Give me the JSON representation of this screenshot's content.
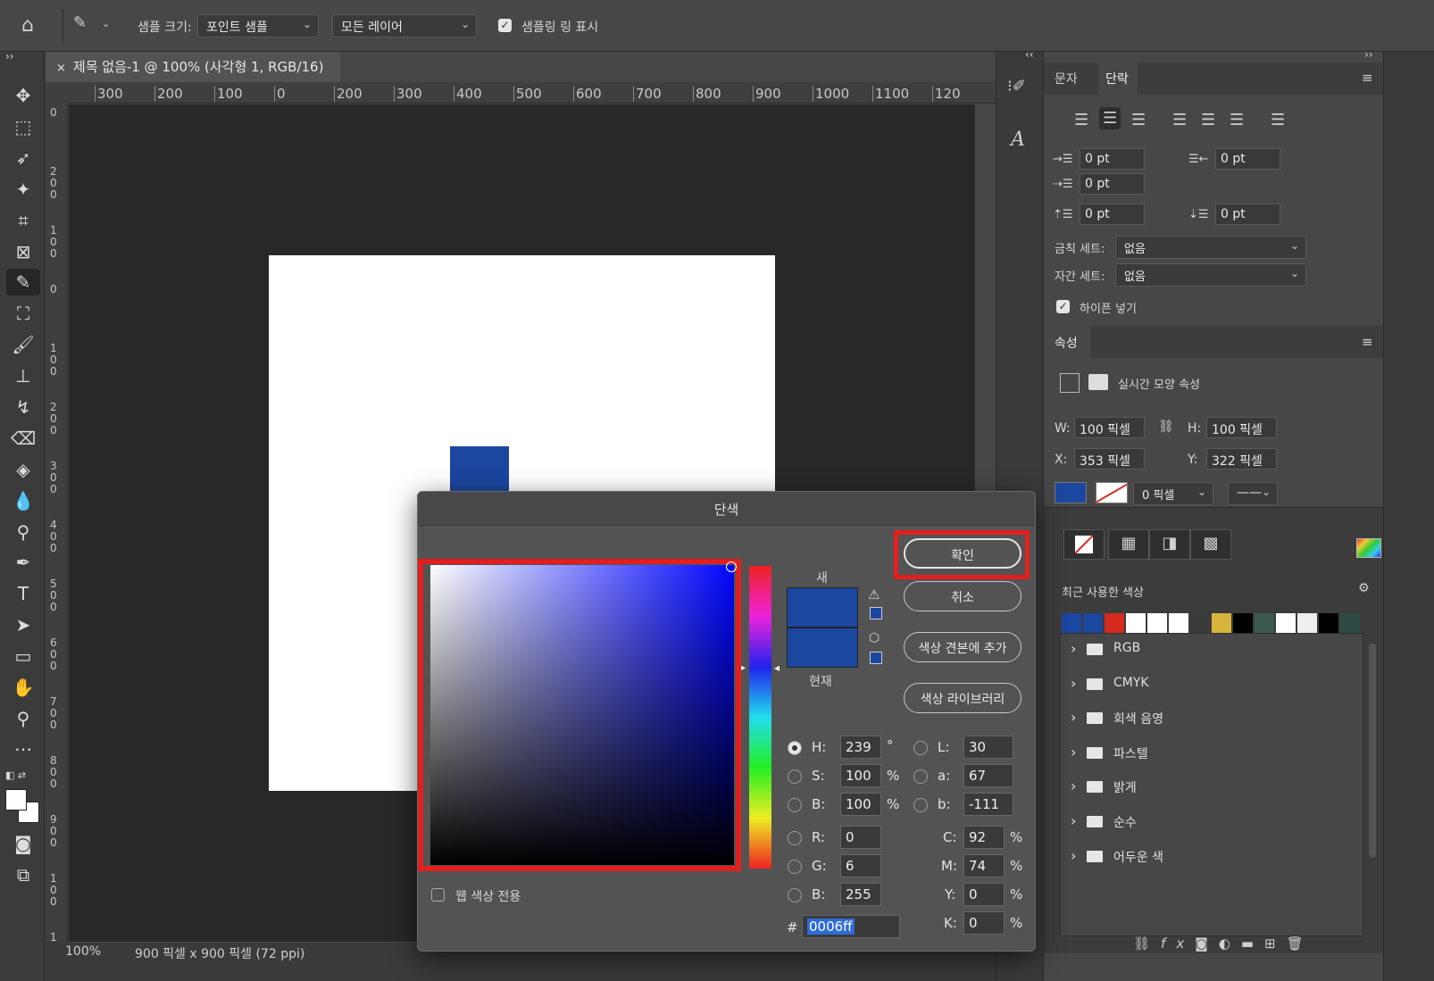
{
  "options_bar": {
    "sample_size_label": "샘플 크기:",
    "sample_size_value": "포인트 샘플",
    "sample_layers_value": "모든 레이어",
    "show_ring_label": "샘플링 링 표시"
  },
  "document": {
    "tab_title": "제목 없음-1 @ 100% (사각형 1, RGB/16)",
    "zoom": "100%",
    "info": "900 픽셀 x 900 픽셀 (72 ppi)",
    "shape_color": "#1c47a0",
    "ruler_h": [
      "300",
      "200",
      "100",
      "0",
      "200",
      "300",
      "400",
      "500",
      "600",
      "700",
      "800",
      "900",
      "1000",
      "1100",
      "120"
    ],
    "ruler_v": [
      "0",
      "200",
      "100",
      "0",
      "100",
      "200",
      "300",
      "400",
      "500",
      "600",
      "700",
      "800",
      "900",
      "100",
      "11"
    ]
  },
  "panel": {
    "tabs": {
      "char": "문자",
      "para": "단락"
    },
    "indent_left": "0 pt",
    "indent_right": "0 pt",
    "indent_first": "0 pt",
    "space_before": "0 pt",
    "space_after": "0 pt",
    "kinsoku_label": "금칙 세트:",
    "kinsoku_value": "없음",
    "mojikumi_label": "자간 세트:",
    "mojikumi_value": "없음",
    "hyphen_label": "하이픈 넣기",
    "props_tab": "속성",
    "live_shape_label": "실시간 모양 속성",
    "w_label": "W:",
    "w_value": "100 픽셀",
    "h_label": "H:",
    "h_value": "100 픽셀",
    "x_label": "X:",
    "x_value": "353 픽셀",
    "y_label": "Y:",
    "y_value": "322 픽셀",
    "stroke_width": "0 픽셀",
    "fill_color": "#1c47a0",
    "recent_colors_label": "최근 사용한 색상",
    "recent_colors": [
      "#1c47a0",
      "#1c47a0",
      "#d42b1e",
      "#ffffff",
      "#ffffff",
      "#ffffff",
      "#3a3a3a",
      "#d8b43c",
      "#000000",
      "#3a5a50",
      "#ffffff",
      "#eeeeee",
      "#000000",
      "#2e4a44"
    ],
    "folders": [
      "RGB",
      "CMYK",
      "회색 음영",
      "파스텔",
      "밝게",
      "순수",
      "어두운 색"
    ]
  },
  "dialog": {
    "title": "단색",
    "ok": "확인",
    "cancel": "취소",
    "add_swatch": "색상 견본에 추가",
    "libraries": "색상 라이브러리",
    "new_label": "새",
    "current_label": "현재",
    "web_only": "웹 색상 전용",
    "new_color": "#1c47a0",
    "current_color": "#1c47a0",
    "hsb": {
      "h_label": "H:",
      "h": "239",
      "h_unit": "°",
      "s_label": "S:",
      "s": "100",
      "s_unit": "%",
      "b_label": "B:",
      "b": "100",
      "b_unit": "%"
    },
    "lab": {
      "l_label": "L:",
      "l": "30",
      "a_label": "a:",
      "a": "67",
      "b_label": "b:",
      "b": "-111"
    },
    "rgb": {
      "r_label": "R:",
      "r": "0",
      "g_label": "G:",
      "g": "6",
      "b_label": "B:",
      "b": "255"
    },
    "cmyk": {
      "c_label": "C:",
      "c": "92",
      "m_label": "M:",
      "m": "74",
      "y_label": "Y:",
      "y": "0",
      "k_label": "K:",
      "k": "0",
      "unit": "%"
    },
    "hex_label": "#",
    "hex": "0006ff"
  }
}
